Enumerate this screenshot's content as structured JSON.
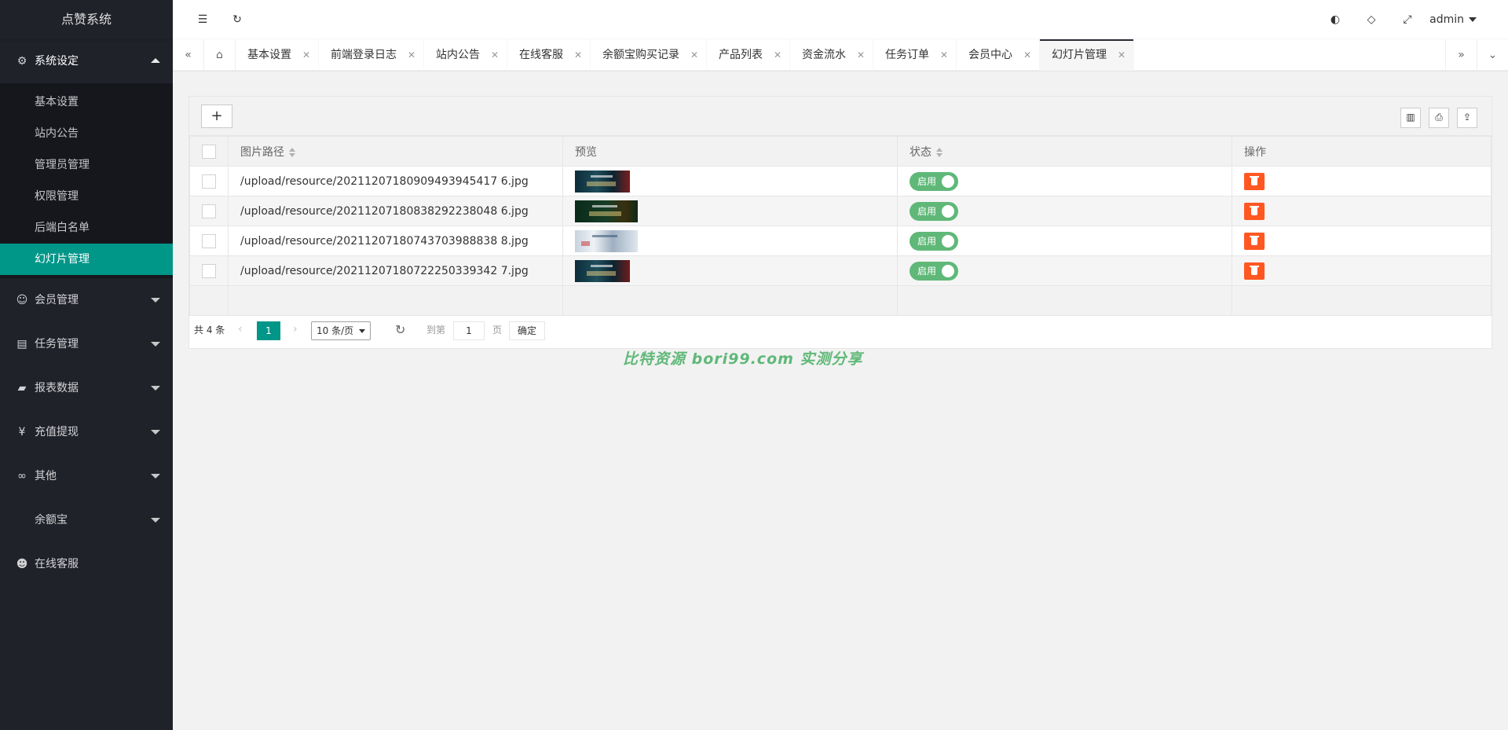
{
  "app": {
    "title": "点赞系统",
    "user": "admin"
  },
  "sidebar": {
    "groups": [
      {
        "label": "系统设定",
        "icon": "gear-icon",
        "open": true,
        "items": [
          "基本设置",
          "站内公告",
          "管理员管理",
          "权限管理",
          "后端白名单",
          "幻灯片管理"
        ]
      },
      {
        "label": "会员管理",
        "icon": "user-icon"
      },
      {
        "label": "任务管理",
        "icon": "document-icon"
      },
      {
        "label": "报表数据",
        "icon": "chart-icon"
      },
      {
        "label": "充值提现",
        "icon": "yen-icon"
      },
      {
        "label": "其他",
        "icon": "link-icon"
      },
      {
        "label": "余额宝",
        "icon": ""
      },
      {
        "label": "在线客服",
        "icon": "service-icon"
      }
    ],
    "active_item": "幻灯片管理"
  },
  "tabs": [
    {
      "label": "基本设置"
    },
    {
      "label": "前端登录日志"
    },
    {
      "label": "站内公告"
    },
    {
      "label": "在线客服"
    },
    {
      "label": "余额宝购买记录"
    },
    {
      "label": "产品列表"
    },
    {
      "label": "资金流水"
    },
    {
      "label": "任务订单"
    },
    {
      "label": "会员中心"
    },
    {
      "label": "幻灯片管理",
      "active": true
    }
  ],
  "toolbar": {
    "add_label": "+"
  },
  "table": {
    "headers": {
      "path": "图片路径",
      "preview": "预览",
      "status": "状态",
      "action": "操作"
    },
    "rows": [
      {
        "path": "/upload/resource/20211207180909493945417 6.jpg",
        "status": "启用"
      },
      {
        "path": "/upload/resource/20211207180838292238048 6.jpg",
        "status": "启用"
      },
      {
        "path": "/upload/resource/20211207180743703988838 8.jpg",
        "status": "启用"
      },
      {
        "path": "/upload/resource/20211207180722250339342 7.jpg",
        "status": "启用"
      }
    ]
  },
  "pager": {
    "total": "共 4 条",
    "current": "1",
    "per_page": "10 条/页",
    "goto_prefix": "到第",
    "goto_value": "1",
    "goto_suffix": "页",
    "confirm": "确定"
  },
  "watermark": "比特资源 bori99.com 实测分享",
  "colors": {
    "accent": "#009688",
    "switch_on": "#5fb878",
    "danger": "#ff5722",
    "sidebar": "#20222a"
  }
}
